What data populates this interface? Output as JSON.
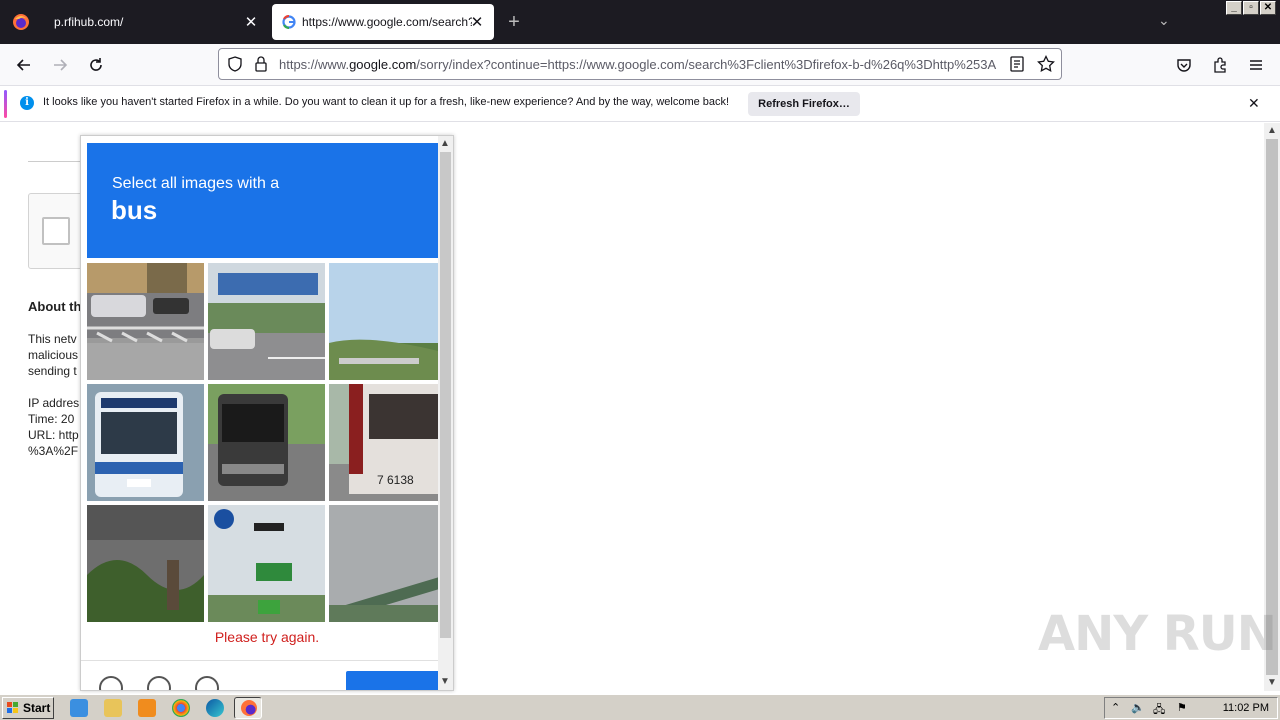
{
  "browser": {
    "tabs": [
      {
        "title": "p.rfihub.com/",
        "close": "✕"
      },
      {
        "title": "https://www.google.com/search?c",
        "close": "✕"
      }
    ],
    "new_tab": "+",
    "url_prefix": "https://www.",
    "url_domain": "google.com",
    "url_rest": "/sorry/index?continue=https://www.google.com/search%3Fclient%3Dfirefox-b-d%26q%3Dhttp%253A",
    "window_controls": [
      "_",
      "▫",
      "✕"
    ]
  },
  "notification": {
    "message": "It looks like you haven't started Firefox in a while. Do you want to clean it up for a fresh, like-new experience? And by the way, welcome back!",
    "button": "Refresh Firefox…",
    "info_glyph": "i",
    "close": "✕"
  },
  "sorry_page": {
    "about_heading": "About th",
    "para1_line1": "This netv",
    "para1_line2": "malicious",
    "para1_line3": "sending t",
    "ip_line": "IP addres",
    "time_line": "Time: 20",
    "url_line": "URL: http",
    "url_line2": "%3A%2F"
  },
  "captcha": {
    "instruction": "Select all images with a",
    "target": "bus",
    "error": "Please try again.",
    "tiles": [
      {
        "name": "street-crosswalk",
        "selected": false
      },
      {
        "name": "highway-billboard",
        "selected": false
      },
      {
        "name": "trees-sky",
        "selected": false
      },
      {
        "name": "bus-front",
        "selected": false
      },
      {
        "name": "bus-front-dark",
        "selected": false
      },
      {
        "name": "bus-side-7138",
        "selected": false
      },
      {
        "name": "roadside-plants",
        "selected": false
      },
      {
        "name": "traffic-signs",
        "selected": false
      },
      {
        "name": "overpass",
        "selected": false
      }
    ],
    "tile_label_7138": "7 6138"
  },
  "watermark": "ANY RUN",
  "taskbar": {
    "start": "Start",
    "clock": "11:02 PM"
  }
}
